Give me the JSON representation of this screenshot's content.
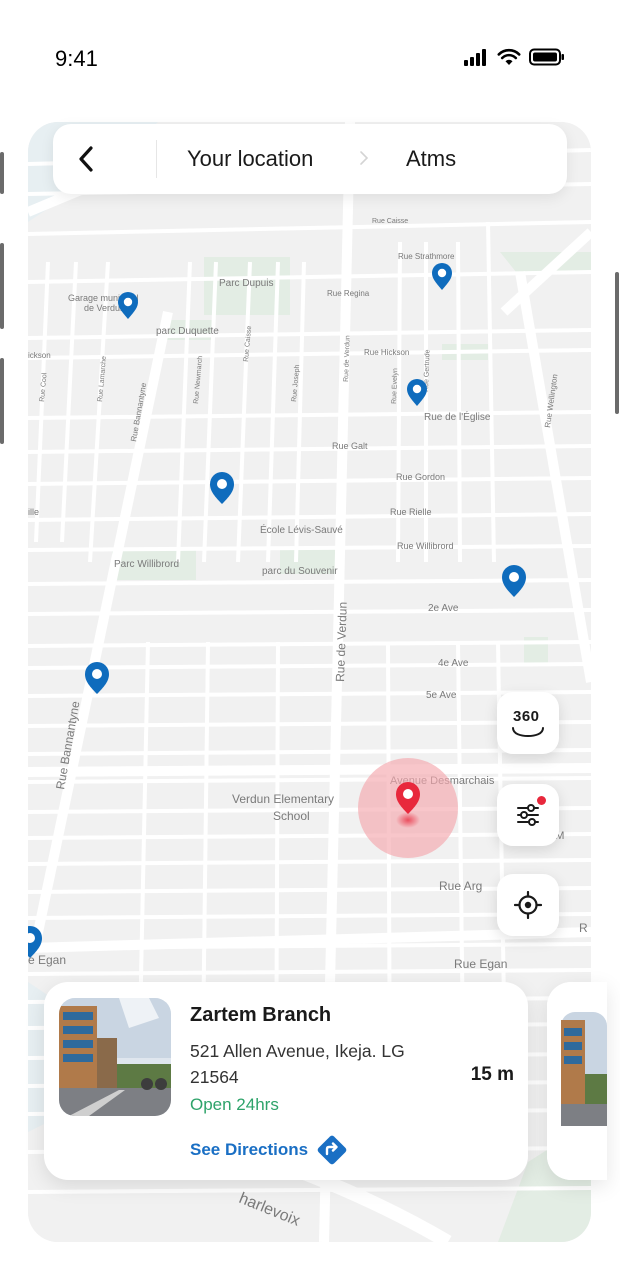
{
  "status_bar": {
    "time": "9:41"
  },
  "header": {
    "breadcrumb": [
      "Your location",
      "Atms"
    ]
  },
  "map": {
    "labels": {
      "parc_dupuis": "Parc Dupuis",
      "garage_1": "Garage municipal",
      "garage_2": "de Verdun",
      "parc_duquette": "parc Duquette",
      "rue_hickson_left": "ickson",
      "rue_cool": "Rue Cool",
      "rue_lamarche": "Rue Lamarche",
      "rue_bannantyne_top": "Rue Bannantyne",
      "rue_newmarch": "Rue Newmarch",
      "rue_caisse": "Rue Caisse",
      "rue_joseph": "Rue Joseph",
      "rue_de_verdun_top": "Rue de Verdun",
      "rue_regina": "Rue Regina",
      "rue_hickson": "Rue Hickson",
      "rue_strathmore": "Rue Strathmore",
      "rue_evelyn": "Rue Evelyn",
      "rue_gertrude": "Rue Gertrude",
      "rue_eglise": "Rue de l'Église",
      "rue_wellington": "Rue Wellington",
      "rue_galt": "Rue Galt",
      "rue_gordon": "Rue Gordon",
      "rue_rielle": "Rue Rielle",
      "rielle_left": "ille",
      "ecole": "École Lévis-Sauvé",
      "rue_willibrord": "Rue Willibrord",
      "parc_willibrord": "Parc Willibrord",
      "parc_souvenir": "parc du Souvenir",
      "ave_2e": "2e Ave",
      "rue_de_verdun": "Rue de Verdun",
      "ave_4e": "4e Ave",
      "ave_5e": "5e Ave",
      "rue_bannantyne": "Rue Bannantyne",
      "avenue_desmarchais": "Avenue Desmarchais",
      "verdun_school_1": "Verdun Elementary",
      "verdun_school_2": "School",
      "rue_m": "ue M",
      "rue_arg": "Rue Arg",
      "r_right": "R",
      "egan_left": "e Egan",
      "rue_egan": "Rue Egan",
      "charlevoix": "harlevoix"
    }
  },
  "controls": {
    "view_360_label": "360",
    "filter_icon": "sliders-icon",
    "locate_icon": "crosshair-icon"
  },
  "branch": {
    "name": "Zartem Branch",
    "address": "521 Allen Avenue, Ikeja. LG 21564",
    "distance": "15 m",
    "hours": "Open 24hrs",
    "directions_label": "See Directions"
  },
  "colors": {
    "pin_blue": "#0f6cbd",
    "pin_red": "#e8283c",
    "open_green": "#2ea36a",
    "link_blue": "#1a6fc4"
  }
}
